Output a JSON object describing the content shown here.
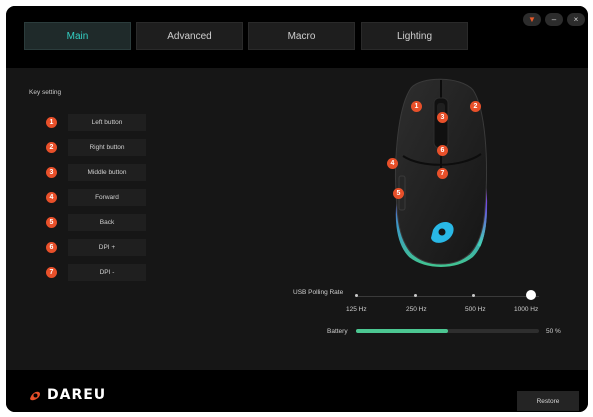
{
  "tabs": [
    {
      "label": "Main",
      "active": true
    },
    {
      "label": "Advanced",
      "active": false
    },
    {
      "label": "Macro",
      "active": false
    },
    {
      "label": "Lighting",
      "active": false
    }
  ],
  "window_controls": {
    "menu_icon": "triangle-down-icon",
    "min_icon": "minus-icon",
    "close_icon": "close-icon",
    "menu_glyph": "▼",
    "min_glyph": "–",
    "close_glyph": "×"
  },
  "key_setting": {
    "title": "Key setting",
    "keys": [
      {
        "num": "1",
        "label": "Left button"
      },
      {
        "num": "2",
        "label": "Right button"
      },
      {
        "num": "3",
        "label": "Middle button"
      },
      {
        "num": "4",
        "label": "Forward"
      },
      {
        "num": "5",
        "label": "Back"
      },
      {
        "num": "6",
        "label": "DPI +"
      },
      {
        "num": "7",
        "label": "DPI -"
      }
    ]
  },
  "mouse_badges": [
    "1",
    "2",
    "3",
    "4",
    "5",
    "6",
    "7"
  ],
  "polling": {
    "label": "USB Polling Rate",
    "options": [
      "125 Hz",
      "250 Hz",
      "500 Hz",
      "1000 Hz"
    ],
    "selected": "1000 Hz"
  },
  "battery": {
    "label": "Battery",
    "value": "50 %",
    "percent": 0.5
  },
  "footer": {
    "brand": "DAREU",
    "restore_label": "Restore"
  },
  "colors": {
    "accent": "#33d0c4",
    "badge": "#e8502a",
    "battery": "#4cc792"
  }
}
